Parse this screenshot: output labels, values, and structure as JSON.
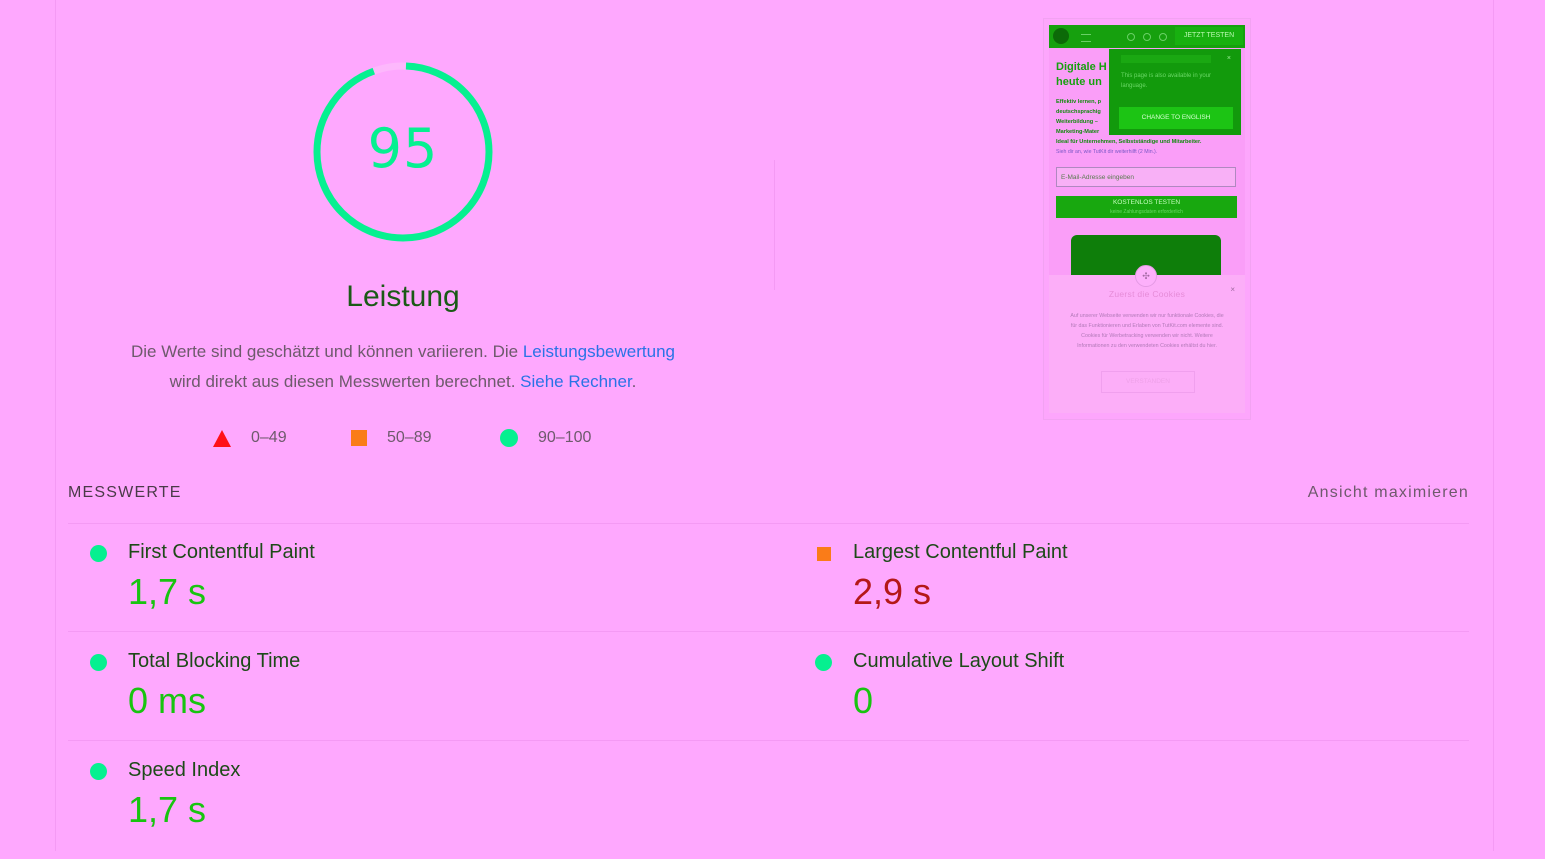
{
  "gauge": {
    "score": "95",
    "fraction": 0.95,
    "title": "Leistung",
    "color": "#06f090"
  },
  "description": {
    "part1": "Die Werte sind geschätzt und können variieren. Die ",
    "link1": "Leistungsbewertung",
    "part2": " wird direkt aus diesen Messwerten berechnet. ",
    "link2": "Siehe Rechner",
    "part3": "."
  },
  "legend": [
    {
      "shape": "triangle-icon",
      "range": "0–49",
      "color": "#ff1018"
    },
    {
      "shape": "square-icon",
      "range": "50–89",
      "color": "#fa7c18"
    },
    {
      "shape": "circle-icon",
      "range": "90–100",
      "color": "#06f090"
    }
  ],
  "screenshot": {
    "header_cta": "JETZT TESTEN",
    "heading": "Digitale H heute un",
    "body_lines": [
      "Effektiv lernen, p",
      "deutschsprachig",
      "Weiterbildung –",
      "Marketing-Mater",
      "Ideal für Unternehmen, Selbstständige und Mitarbeiter."
    ],
    "body_link": "Sieh dir an, wie TutKit dir weiterhilft (2 Min.).",
    "popover_text": "This page is also available in your language.",
    "popover_button": "CHANGE TO ENGLISH",
    "email_placeholder": "E-Mail-Adresse eingeben",
    "primary_button": "KOSTENLOS TESTEN",
    "primary_sub": "keine Zahlungsdaten erforderlich",
    "cookie_title": "Zuerst die Cookies",
    "cookie_text": "Auf unserer Webseite verwenden wir nur funktionale Cookies, die für das Funktionieren und Erlaben von TutKit.com elemente sind. Cookies für Werbetracking verwenden wir nicht. Weitere Informationen zu den verwendeten Cookies erhältst du hier.",
    "cookie_button": "VERSTANDEN"
  },
  "metrics": {
    "section_title": "MESSWERTE",
    "toggle_label": "Ansicht maximieren",
    "items": [
      {
        "label": "First Contentful Paint",
        "value": "1,7 s",
        "rating": "good"
      },
      {
        "label": "Largest Contentful Paint",
        "value": "2,9 s",
        "rating": "average"
      },
      {
        "label": "Total Blocking Time",
        "value": "0 ms",
        "rating": "good"
      },
      {
        "label": "Cumulative Layout Shift",
        "value": "0",
        "rating": "good"
      },
      {
        "label": "Speed Index",
        "value": "1,7 s",
        "rating": "good"
      }
    ]
  },
  "colors": {
    "background": "#fea8fe",
    "good": "#06f090",
    "average": "#fa7c18",
    "fail": "#ff1018",
    "link": "#2a73e6"
  }
}
